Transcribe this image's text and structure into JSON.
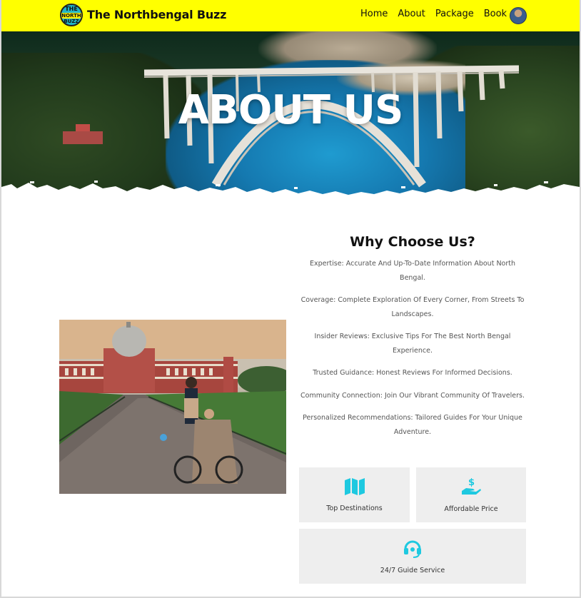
{
  "header": {
    "logo": {
      "line1": "THE",
      "line2": "NORTH",
      "line3": "BUZZ"
    },
    "brand": "The Northbengal Buzz",
    "nav": [
      {
        "label": "Home"
      },
      {
        "label": "About"
      },
      {
        "label": "Package"
      },
      {
        "label": "Book"
      }
    ],
    "background_color": "#ffff00"
  },
  "hero": {
    "title": "ABOUT US"
  },
  "why": {
    "title": "Why Choose Us?",
    "points": [
      "Expertise: Accurate And Up-To-Date Information About North Bengal.",
      "Coverage: Complete Exploration Of Every Corner, From Streets To Landscapes.",
      "Insider Reviews: Exclusive Tips For The Best North Bengal Experience.",
      "Trusted Guidance: Honest Reviews For Informed Decisions.",
      "Community Connection: Join Our Vibrant Community Of Travelers.",
      "Personalized Recommendations: Tailored Guides For Your Unique Adventure."
    ]
  },
  "features": [
    {
      "label": "Top Destinations",
      "icon": "map-icon"
    },
    {
      "label": "Affordable Price",
      "icon": "hand-dollar-icon"
    },
    {
      "label": "24/7 Guide Service",
      "icon": "headset-icon"
    }
  ],
  "colors": {
    "accent": "#1ec9e0",
    "card_bg": "#eeeeee"
  }
}
